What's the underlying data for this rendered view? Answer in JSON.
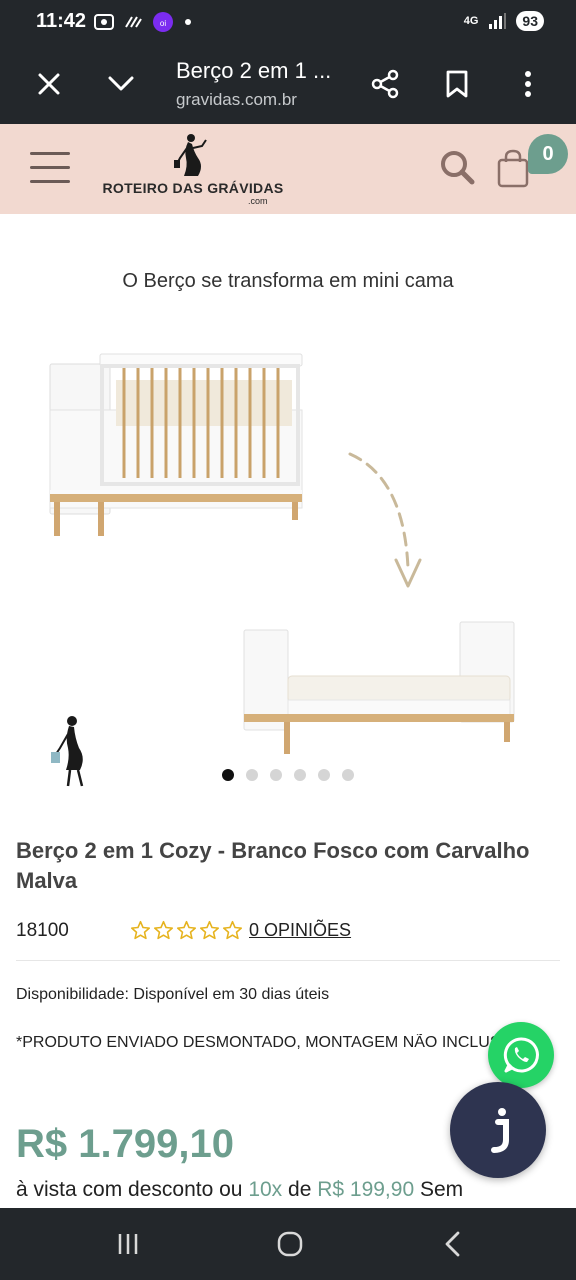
{
  "status_bar": {
    "time": "11:42",
    "network": "4G",
    "battery": "93"
  },
  "browser": {
    "title": "Berço 2 em 1 ...",
    "url": "gravidas.com.br"
  },
  "site": {
    "logo_text": "ROTEIRO DAS GRÁVIDAS",
    "logo_sub": ".com",
    "cart_count": "0"
  },
  "gallery": {
    "caption": "O Berço se transforma em mini cama",
    "dot_count": 6,
    "active_dot": 0
  },
  "product": {
    "title": "Berço 2 em 1 Cozy - Branco Fosco com Carvalho Malva",
    "sku": "18100",
    "rating_stars": 5,
    "rating_filled": 0,
    "reviews_link": "0 OPINIÕES",
    "availability": "Disponibilidade: Disponível em 30 dias úteis",
    "notice": "*PRODUTO ENVIADO DESMONTADO, MONTAGEM NÃO INCLUSA*",
    "price": "R$ 1.799,10",
    "installments_prefix": "à vista com desconto ou",
    "installments_count": "10x",
    "installments_mid": "de",
    "installments_value": "R$ 199,90",
    "installments_suffix": "Sem"
  },
  "colors": {
    "accent": "#6d9e8e",
    "header_bg": "#f2d9d0",
    "dark_bar": "#23272b",
    "whatsapp": "#25d366",
    "chat": "#2e3450",
    "star": "#e6b31e"
  }
}
